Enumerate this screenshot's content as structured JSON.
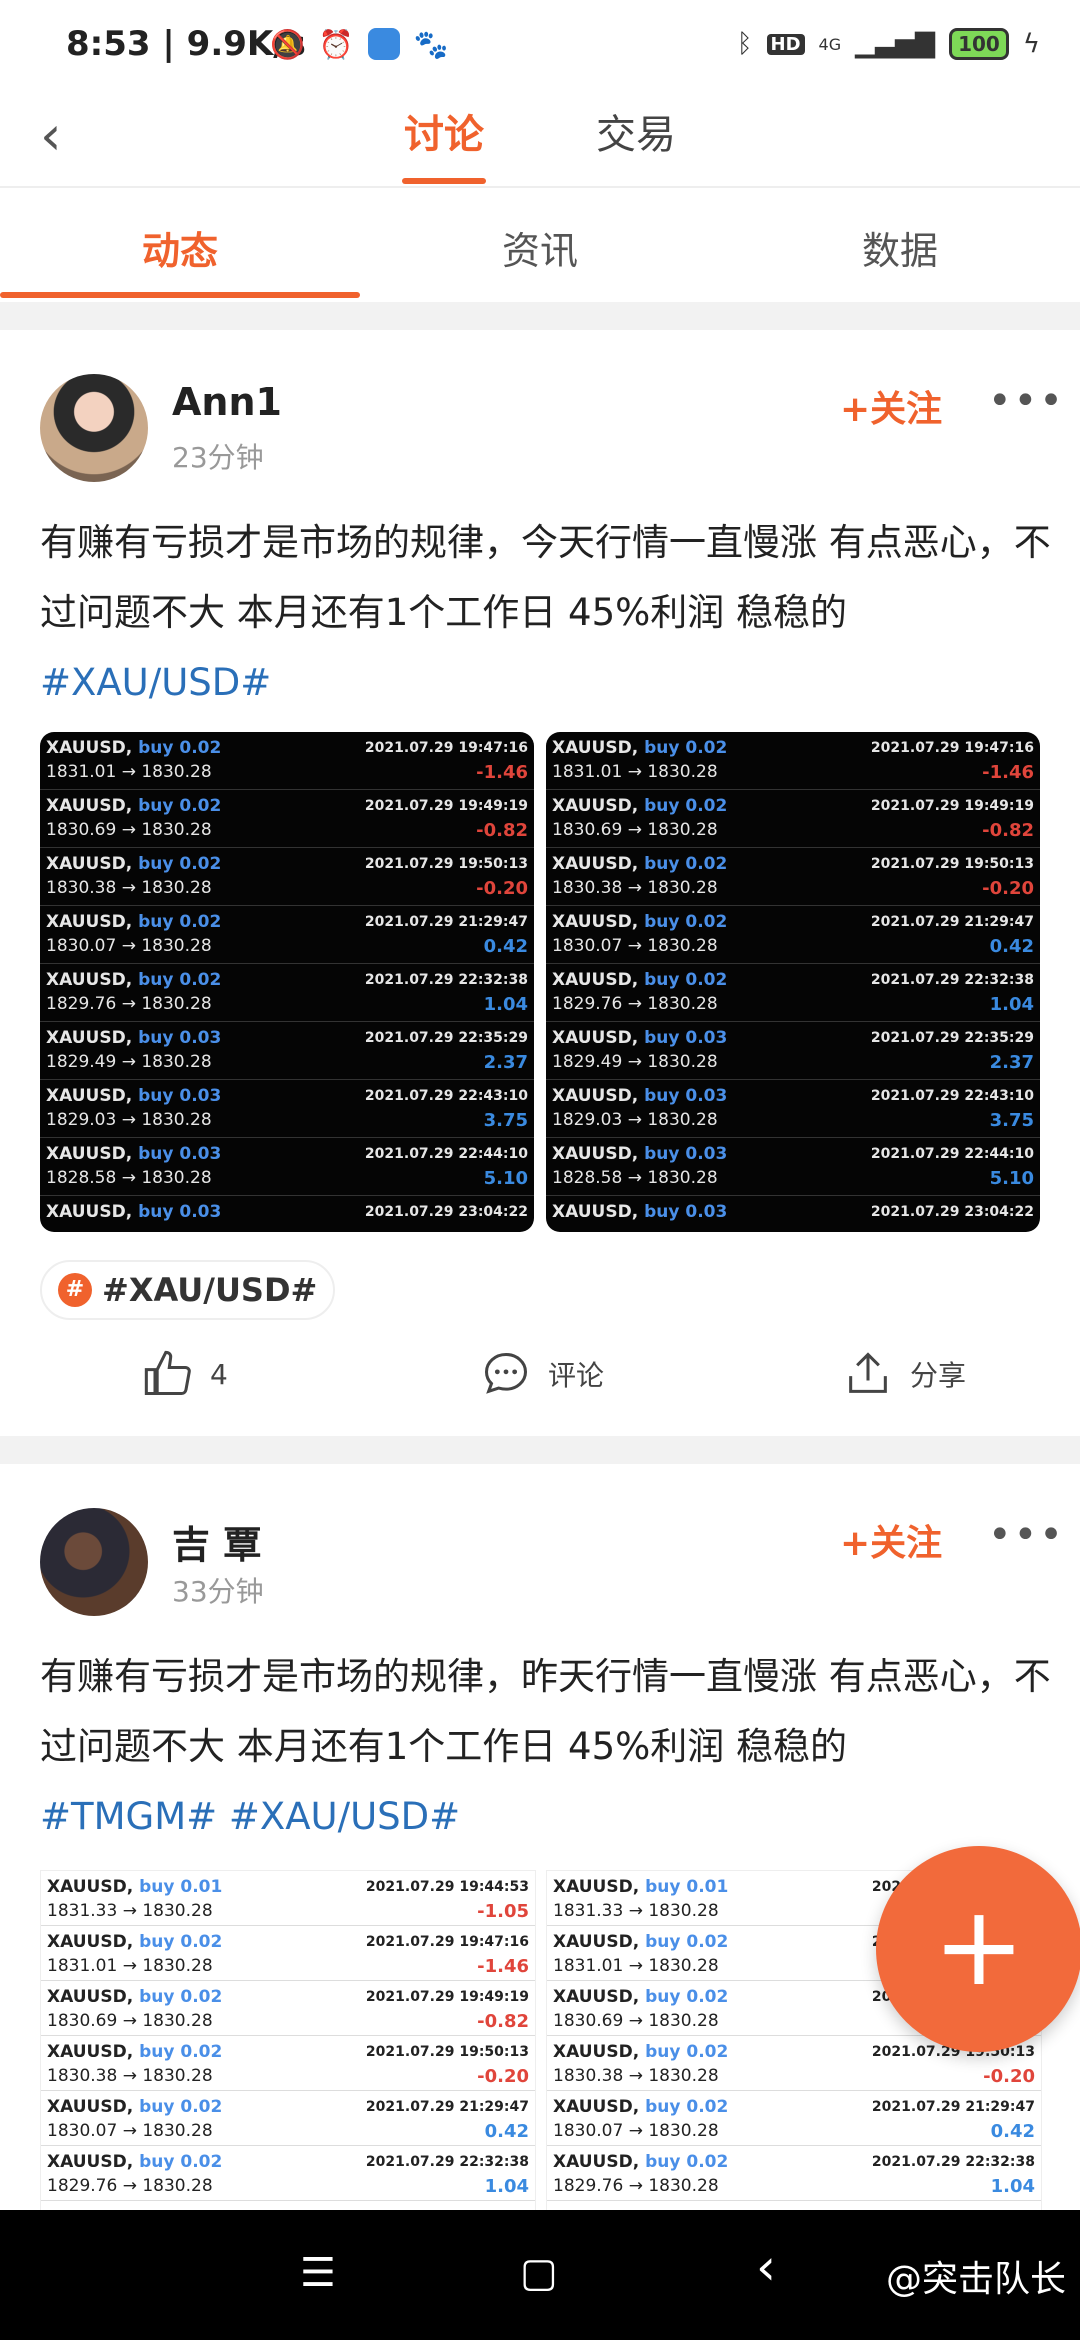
{
  "status_bar": {
    "time": "8:53 | 9.9K/s",
    "icons": [
      "mute-bell-icon",
      "alarm-icon",
      "app-icon",
      "baidu-icon"
    ],
    "network": "4G",
    "hd": "HD",
    "battery": "100"
  },
  "top_nav": {
    "back_icon": "chevron-left-icon",
    "tabs": [
      "讨论",
      "交易"
    ],
    "active_tab": "讨论"
  },
  "sub_tabs": {
    "tabs": [
      "动态",
      "资讯",
      "数据"
    ],
    "active_tab": "动态"
  },
  "posts": [
    {
      "username": "Ann1",
      "time": "23分钟",
      "follow": "+关注",
      "more": "•••",
      "text": "有赚有亏损才是市场的规律，今天行情一直慢涨 有点恶心，不过问题不大 本月还有1个工作日 45%利润 稳稳的",
      "tags": [
        "#XAU/USD#"
      ],
      "topic_chip": "#XAU/USD#",
      "likes": "4",
      "comment": "评论",
      "share": "分享",
      "trades": [
        {
          "sym": "XAUUSD,",
          "side": "buy 0.02",
          "time": "2021.07.29 19:47:16",
          "px": "1831.01 → 1830.28",
          "pl": "-1.46"
        },
        {
          "sym": "XAUUSD,",
          "side": "buy 0.02",
          "time": "2021.07.29 19:49:19",
          "px": "1830.69 → 1830.28",
          "pl": "-0.82"
        },
        {
          "sym": "XAUUSD,",
          "side": "buy 0.02",
          "time": "2021.07.29 19:50:13",
          "px": "1830.38 → 1830.28",
          "pl": "-0.20"
        },
        {
          "sym": "XAUUSD,",
          "side": "buy 0.02",
          "time": "2021.07.29 21:29:47",
          "px": "1830.07 → 1830.28",
          "pl": "0.42"
        },
        {
          "sym": "XAUUSD,",
          "side": "buy 0.02",
          "time": "2021.07.29 22:32:38",
          "px": "1829.76 → 1830.28",
          "pl": "1.04"
        },
        {
          "sym": "XAUUSD,",
          "side": "buy 0.03",
          "time": "2021.07.29 22:35:29",
          "px": "1829.49 → 1830.28",
          "pl": "2.37"
        },
        {
          "sym": "XAUUSD,",
          "side": "buy 0.03",
          "time": "2021.07.29 22:43:10",
          "px": "1829.03 → 1830.28",
          "pl": "3.75"
        },
        {
          "sym": "XAUUSD,",
          "side": "buy 0.03",
          "time": "2021.07.29 22:44:10",
          "px": "1828.58 → 1830.28",
          "pl": "5.10"
        },
        {
          "sym": "XAUUSD,",
          "side": "buy 0.03",
          "time": "2021.07.29 23:04:22",
          "px": "",
          "pl": ""
        }
      ]
    },
    {
      "username": "吉 覃",
      "time": "33分钟",
      "follow": "+关注",
      "more": "•••",
      "text": "有赚有亏损才是市场的规律，昨天行情一直慢涨 有点恶心，不过问题不大 本月还有1个工作日 45%利润 稳稳的",
      "tags": [
        "#TMGM#",
        "#XAU/USD#"
      ],
      "trades": [
        {
          "sym": "XAUUSD,",
          "side": "buy 0.01",
          "time": "2021.07.29 19:44:53",
          "px": "1831.33 → 1830.28",
          "pl": "-1.05"
        },
        {
          "sym": "XAUUSD,",
          "side": "buy 0.02",
          "time": "2021.07.29 19:47:16",
          "px": "1831.01 → 1830.28",
          "pl": "-1.46"
        },
        {
          "sym": "XAUUSD,",
          "side": "buy 0.02",
          "time": "2021.07.29 19:49:19",
          "px": "1830.69 → 1830.28",
          "pl": "-0.82"
        },
        {
          "sym": "XAUUSD,",
          "side": "buy 0.02",
          "time": "2021.07.29 19:50:13",
          "px": "1830.38 → 1830.28",
          "pl": "-0.20"
        },
        {
          "sym": "XAUUSD,",
          "side": "buy 0.02",
          "time": "2021.07.29 21:29:47",
          "px": "1830.07 → 1830.28",
          "pl": "0.42"
        },
        {
          "sym": "XAUUSD,",
          "side": "buy 0.02",
          "time": "2021.07.29 22:32:38",
          "px": "1829.76 → 1830.28",
          "pl": "1.04"
        }
      ]
    }
  ],
  "fab": {
    "label": "+"
  },
  "bottom_nav": {
    "menu_icon": "☰",
    "home_icon": "▢",
    "back_icon": "‹",
    "watermark": "@突击队长"
  }
}
